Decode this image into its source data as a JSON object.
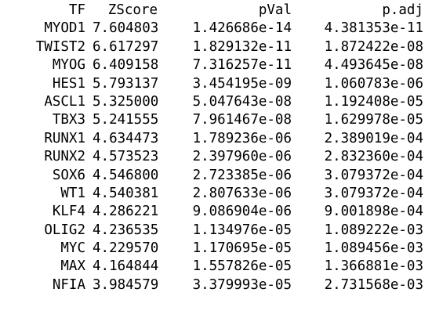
{
  "table": {
    "columns": [
      "TF",
      "ZScore",
      "pVal",
      "p.adj"
    ],
    "rows": [
      [
        "MYOD1",
        "7.604803",
        "1.426686e-14",
        "4.381353e-11"
      ],
      [
        "TWIST2",
        "6.617297",
        "1.829132e-11",
        "1.872422e-08"
      ],
      [
        "MYOG",
        "6.409158",
        "7.316257e-11",
        "4.493645e-08"
      ],
      [
        "HES1",
        "5.793137",
        "3.454195e-09",
        "1.060783e-06"
      ],
      [
        "ASCL1",
        "5.325000",
        "5.047643e-08",
        "1.192408e-05"
      ],
      [
        "TBX3",
        "5.241555",
        "7.961467e-08",
        "1.629978e-05"
      ],
      [
        "RUNX1",
        "4.634473",
        "1.789236e-06",
        "2.389019e-04"
      ],
      [
        "RUNX2",
        "4.573523",
        "2.397960e-06",
        "2.832360e-04"
      ],
      [
        "SOX6",
        "4.546800",
        "2.723385e-06",
        "3.079372e-04"
      ],
      [
        "WT1",
        "4.540381",
        "2.807633e-06",
        "3.079372e-04"
      ],
      [
        "KLF4",
        "4.286221",
        "9.086904e-06",
        "9.001898e-04"
      ],
      [
        "OLIG2",
        "4.236535",
        "1.134976e-05",
        "1.089222e-03"
      ],
      [
        "MYC",
        "4.229570",
        "1.170695e-05",
        "1.089456e-03"
      ],
      [
        "MAX",
        "4.164844",
        "1.557826e-05",
        "1.366881e-03"
      ],
      [
        "NFIA",
        "3.984579",
        "3.379993e-05",
        "2.731568e-03"
      ]
    ]
  }
}
